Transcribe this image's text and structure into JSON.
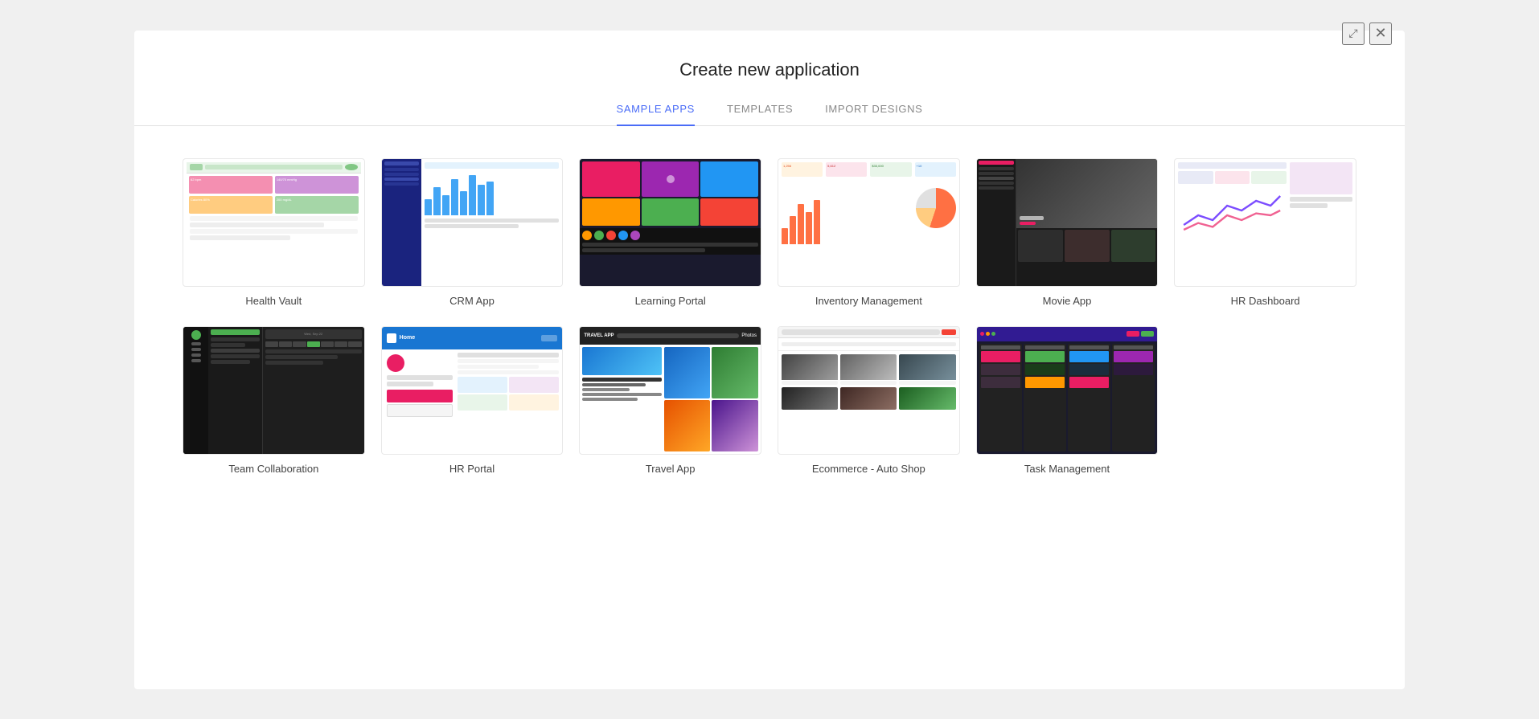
{
  "modal": {
    "title": "Create new application",
    "collapse_label": "⤢",
    "close_label": "✕"
  },
  "tabs": [
    {
      "id": "sample-apps",
      "label": "SAMPLE APPS",
      "active": true
    },
    {
      "id": "templates",
      "label": "TEMPLATES",
      "active": false
    },
    {
      "id": "import-designs",
      "label": "IMPORT DESIGNS",
      "active": false
    }
  ],
  "apps_row1": [
    {
      "id": "health-vault",
      "label": "Health Vault"
    },
    {
      "id": "crm-app",
      "label": "CRM App"
    },
    {
      "id": "learning-portal",
      "label": "Learning Portal"
    },
    {
      "id": "inventory-management",
      "label": "Inventory Management"
    },
    {
      "id": "movie-app",
      "label": "Movie App"
    },
    {
      "id": "hr-dashboard",
      "label": "HR Dashboard"
    }
  ],
  "apps_row2": [
    {
      "id": "team-collaboration",
      "label": "Team Collaboration"
    },
    {
      "id": "hr-portal",
      "label": "HR Portal"
    },
    {
      "id": "travel-app",
      "label": "Travel App"
    },
    {
      "id": "ecommerce-auto-shop",
      "label": "Ecommerce - Auto Shop"
    },
    {
      "id": "task-management",
      "label": "Task Management"
    }
  ]
}
